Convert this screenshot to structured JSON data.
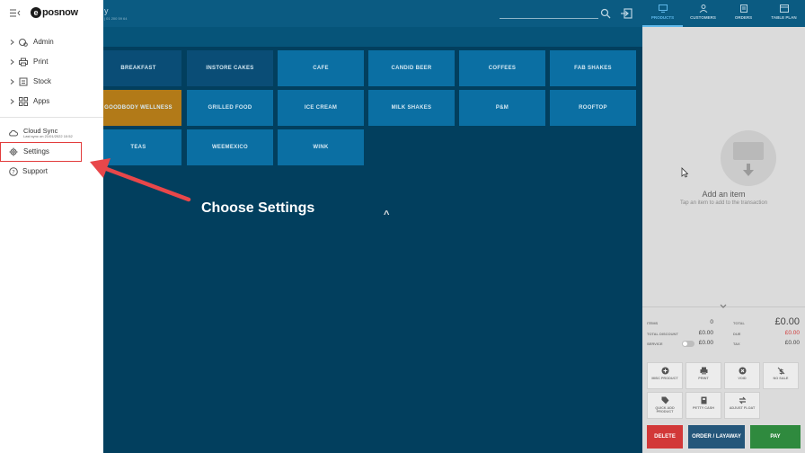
{
  "header": {
    "store_name": "y",
    "store_sub": "| 01 200 59 64"
  },
  "categories": [
    {
      "label": "BREAKFAST",
      "style": "dark"
    },
    {
      "label": "INSTORE CAKES",
      "style": "dark"
    },
    {
      "label": "CAFE",
      "style": "normal"
    },
    {
      "label": "CANDID BEER",
      "style": "normal"
    },
    {
      "label": "COFFEES",
      "style": "normal"
    },
    {
      "label": "FAB SHAKES",
      "style": "normal"
    },
    {
      "label": "GOODBODY WELLNESS",
      "style": "gold"
    },
    {
      "label": "GRILLED FOOD",
      "style": "normal"
    },
    {
      "label": "ICE CREAM",
      "style": "normal"
    },
    {
      "label": "MILK SHAKES",
      "style": "normal"
    },
    {
      "label": "P&M",
      "style": "normal"
    },
    {
      "label": "ROOFTOP",
      "style": "normal"
    },
    {
      "label": "TEAS",
      "style": "normal"
    },
    {
      "label": "WEEMEXICO",
      "style": "normal"
    },
    {
      "label": "WINK",
      "style": "normal"
    }
  ],
  "right_tabs": [
    {
      "label": "PRODUCTS",
      "icon": "monitor-icon",
      "active": true
    },
    {
      "label": "CUSTOMERS",
      "icon": "person-icon",
      "active": false
    },
    {
      "label": "ORDERS",
      "icon": "clipboard-icon",
      "active": false
    },
    {
      "label": "TABLE PLAN",
      "icon": "table-icon",
      "active": false
    }
  ],
  "empty_state": {
    "title": "Add an item",
    "subtitle": "Tap an item to add to the transaction"
  },
  "totals": {
    "items_label": "ITEMS",
    "items_value": "0",
    "discount_label": "TOTAL DISCOUNT",
    "discount_value": "£0.00",
    "service_label": "SERVICE",
    "service_value": "£0.00",
    "total_label": "TOTAL",
    "total_value": "£0.00",
    "due_label": "DUE",
    "due_value": "£0.00",
    "tax_label": "TAX",
    "tax_value": "£0.00"
  },
  "actions": [
    {
      "label": "MISC PRODUCT",
      "icon": "plus-circle-icon"
    },
    {
      "label": "PRINT",
      "icon": "printer-icon"
    },
    {
      "label": "VOID",
      "icon": "x-circle-icon"
    },
    {
      "label": "NO SALE",
      "icon": "no-sale-icon"
    },
    {
      "label": "QUICK ADD PRODUCT",
      "icon": "tag-icon"
    },
    {
      "label": "PETTY CASH",
      "icon": "cash-icon"
    },
    {
      "label": "ADJUST FLOAT",
      "icon": "swap-icon"
    }
  ],
  "bottom": {
    "delete": "DELETE",
    "order": "ORDER / LAYAWAY",
    "pay": "PAY"
  },
  "drawer": {
    "logo_mark": "e",
    "logo_text": "posnow",
    "items": [
      {
        "label": "Admin",
        "icon": "admin-icon"
      },
      {
        "label": "Print",
        "icon": "printer-icon"
      },
      {
        "label": "Stock",
        "icon": "stock-icon"
      },
      {
        "label": "Apps",
        "icon": "apps-icon"
      }
    ],
    "cloud_sync": "Cloud Sync",
    "cloud_sync_sub": "Last sync on 21/01/2022 10:52",
    "settings": "Settings",
    "support": "Support"
  },
  "annotation": {
    "text": "Choose Settings",
    "mark": "^",
    "arrow_color": "#e8474a"
  }
}
